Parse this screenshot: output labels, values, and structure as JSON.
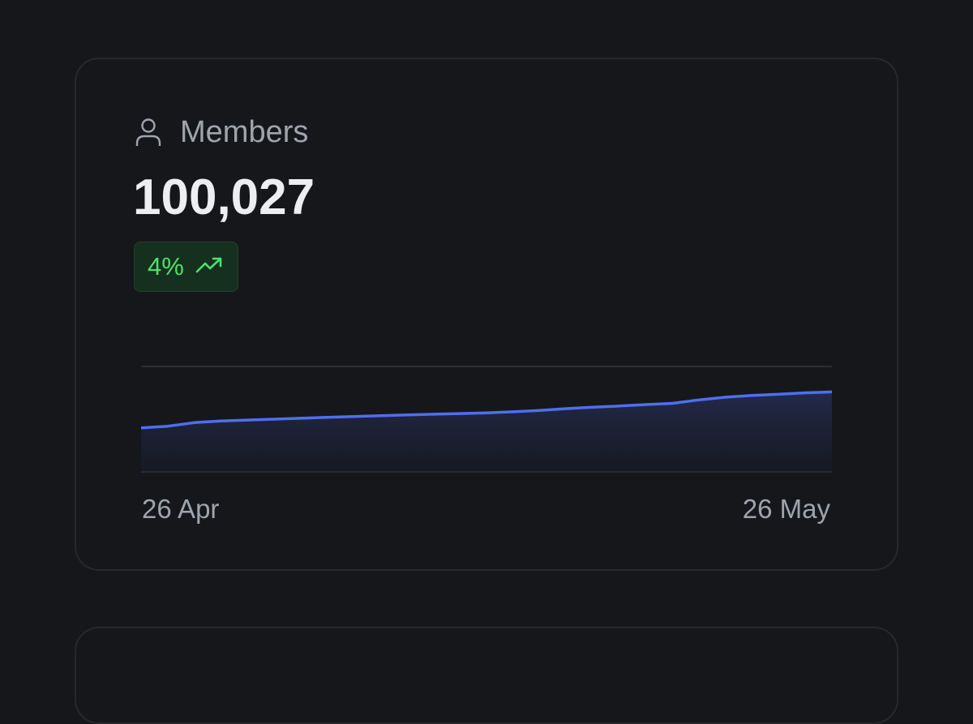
{
  "stat_card": {
    "title": "Members",
    "icon": "user-icon",
    "value": "100,027",
    "change": {
      "label": "4%",
      "direction": "up",
      "icon": "trending-up-icon",
      "color": "#4ee06c"
    }
  },
  "colors": {
    "background": "#16171a",
    "line": "#4f6ef0",
    "badge_bg": "#16301f"
  },
  "chart_data": {
    "type": "area",
    "x_start_label": "26 Apr",
    "x_end_label": "26 May",
    "values": [
      25,
      26,
      28,
      29,
      29.5,
      30,
      30.5,
      31,
      31.5,
      32,
      32.4,
      32.8,
      33.2,
      33.6,
      34.2,
      35,
      36,
      36.8,
      37.5,
      38.3,
      39,
      41,
      42.5,
      43.5,
      44.2,
      45,
      45.5
    ],
    "ylim": [
      0,
      60
    ],
    "grid": true
  }
}
